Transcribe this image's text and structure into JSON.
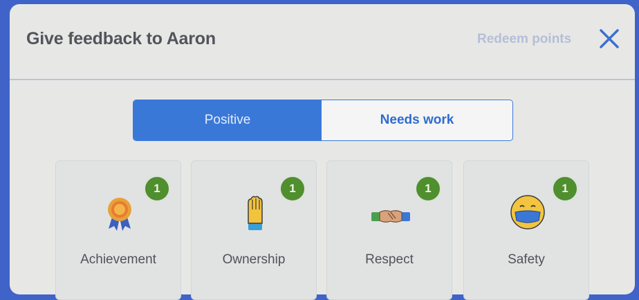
{
  "modal": {
    "title": "Give feedback to Aaron",
    "redeem_link": "Redeem points"
  },
  "toggle": {
    "positive_label": "Positive",
    "needs_work_label": "Needs work",
    "selected": "Positive"
  },
  "cards": [
    {
      "label": "Achievement",
      "count": "1",
      "icon": "award-ribbon-icon"
    },
    {
      "label": "Ownership",
      "count": "1",
      "icon": "raised-hand-icon"
    },
    {
      "label": "Respect",
      "count": "1",
      "icon": "handshake-icon"
    },
    {
      "label": "Safety",
      "count": "1",
      "icon": "face-mask-icon"
    }
  ],
  "colors": {
    "accent": "#3a78d8",
    "badge": "#4f8f2e",
    "background": "#3f63c9",
    "panel": "#e7e8e6"
  }
}
